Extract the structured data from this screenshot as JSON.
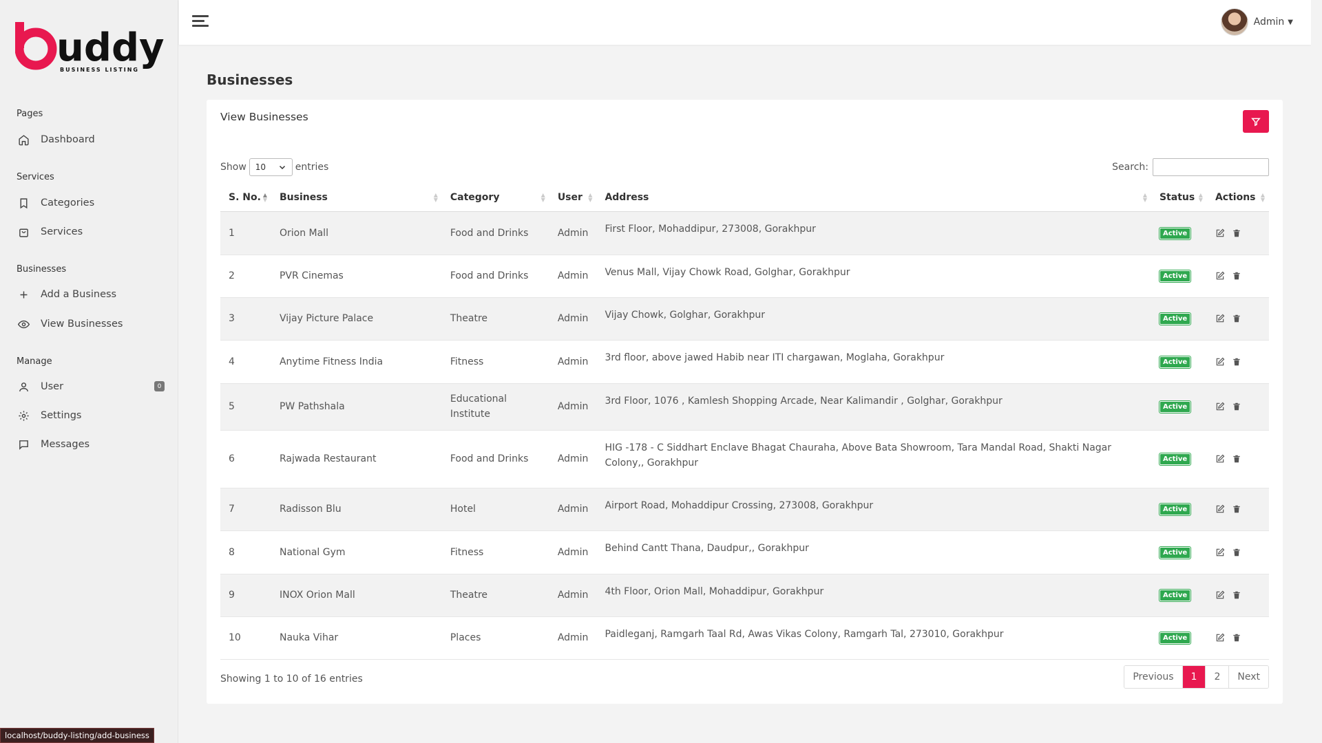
{
  "brand": {
    "logo_text": "buddy",
    "logo_tagline": "BUSINESS LISTING",
    "accent": "#e8184f"
  },
  "sidebar": {
    "sections": [
      {
        "heading": "Pages",
        "items": [
          {
            "label": "Dashboard",
            "icon": "home-icon"
          }
        ]
      },
      {
        "heading": "Services",
        "items": [
          {
            "label": "Categories",
            "icon": "bookmark-icon"
          },
          {
            "label": "Services",
            "icon": "shopping-bag-icon"
          }
        ]
      },
      {
        "heading": "Businesses",
        "items": [
          {
            "label": "Add a Business",
            "icon": "plus-icon"
          },
          {
            "label": "View Businesses",
            "icon": "eye-icon"
          }
        ]
      },
      {
        "heading": "Manage",
        "items": [
          {
            "label": "User",
            "icon": "user-icon",
            "badge": "0"
          },
          {
            "label": "Settings",
            "icon": "gear-icon"
          },
          {
            "label": "Messages",
            "icon": "message-icon"
          }
        ]
      }
    ]
  },
  "topbar": {
    "user_name": "Admin"
  },
  "page": {
    "title": "Businesses"
  },
  "card": {
    "title": "View Businesses",
    "show_label": "Show",
    "entries_label": "entries",
    "page_length": "10",
    "search_label": "Search:",
    "search_value": ""
  },
  "table": {
    "headers": [
      "S. No.",
      "Business",
      "Category",
      "User",
      "Address",
      "Status",
      "Actions"
    ],
    "rows": [
      {
        "sno": "1",
        "business": "Orion Mall",
        "category": "Food and Drinks",
        "user": "Admin",
        "address": "First Floor, Mohaddipur, 273008, Gorakhpur",
        "status": "Active"
      },
      {
        "sno": "2",
        "business": "PVR Cinemas",
        "category": "Food and Drinks",
        "user": "Admin",
        "address": "Venus Mall, Vijay Chowk Road, Golghar, Gorakhpur",
        "status": "Active"
      },
      {
        "sno": "3",
        "business": "Vijay Picture Palace",
        "category": "Theatre",
        "user": "Admin",
        "address": "Vijay Chowk, Golghar, Gorakhpur",
        "status": "Active"
      },
      {
        "sno": "4",
        "business": "Anytime Fitness India",
        "category": "Fitness",
        "user": "Admin",
        "address": "3rd floor, above jawed Habib near ITI chargawan, Moglaha, Gorakhpur",
        "status": "Active"
      },
      {
        "sno": "5",
        "business": "PW Pathshala",
        "category": "Educational Institute",
        "user": "Admin",
        "address": "3rd Floor, 1076 , Kamlesh Shopping Arcade, Near Kalimandir , Golghar, Gorakhpur",
        "status": "Active"
      },
      {
        "sno": "6",
        "business": "Rajwada Restaurant",
        "category": "Food and Drinks",
        "user": "Admin",
        "address": "HIG -178 - C Siddhart Enclave Bhagat Chauraha, Above Bata Showroom, Tara Mandal Road, Shakti Nagar Colony,, Gorakhpur",
        "status": "Active"
      },
      {
        "sno": "7",
        "business": "Radisson Blu",
        "category": "Hotel",
        "user": "Admin",
        "address": "Airport Road, Mohaddipur Crossing, 273008, Gorakhpur",
        "status": "Active"
      },
      {
        "sno": "8",
        "business": "National Gym",
        "category": "Fitness",
        "user": "Admin",
        "address": "Behind Cantt Thana, Daudpur,, Gorakhpur",
        "status": "Active"
      },
      {
        "sno": "9",
        "business": "INOX Orion Mall",
        "category": "Theatre",
        "user": "Admin",
        "address": "4th Floor, Orion Mall, Mohaddipur, Gorakhpur",
        "status": "Active"
      },
      {
        "sno": "10",
        "business": "Nauka Vihar",
        "category": "Places",
        "user": "Admin",
        "address": "Paidleganj, Ramgarh Taal Rd, Awas Vikas Colony, Ramgarh Tal, 273010, Gorakhpur",
        "status": "Active"
      }
    ]
  },
  "footer": {
    "info": "Showing 1 to 10 of 16 entries",
    "previous": "Previous",
    "pages": [
      "1",
      "2"
    ],
    "next": "Next"
  },
  "statusbar": {
    "url": "localhost/buddy-listing/add-business"
  },
  "colors": {
    "active_badge": "#2fa84f",
    "filter_button": "#e8184f"
  }
}
